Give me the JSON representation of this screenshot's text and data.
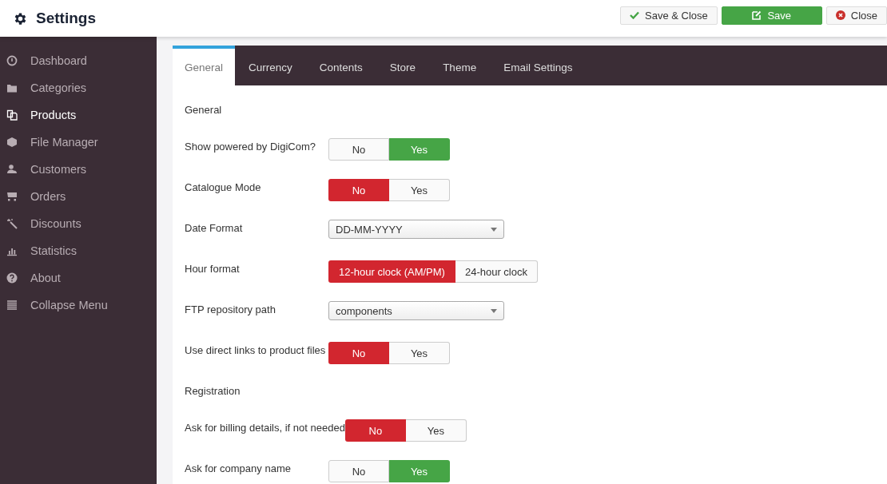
{
  "header": {
    "title": "Settings",
    "buttons": [
      {
        "label": "Save & Close",
        "kind": "save-close"
      },
      {
        "label": "Save",
        "kind": "save"
      },
      {
        "label": "Close",
        "kind": "close"
      }
    ]
  },
  "sidebar": {
    "items": [
      {
        "label": "Dashboard",
        "selected": false
      },
      {
        "label": "Categories",
        "selected": false
      },
      {
        "label": "Products",
        "selected": true
      },
      {
        "label": "File Manager",
        "selected": false
      },
      {
        "label": "Customers",
        "selected": false
      },
      {
        "label": "Orders",
        "selected": false
      },
      {
        "label": "Discounts",
        "selected": false
      },
      {
        "label": "Statistics",
        "selected": false
      },
      {
        "label": "About",
        "selected": false
      },
      {
        "label": "Collapse Menu",
        "selected": false
      }
    ]
  },
  "tabs": [
    {
      "label": "General",
      "selected": true
    },
    {
      "label": "Currency",
      "selected": false
    },
    {
      "label": "Contents",
      "selected": false
    },
    {
      "label": "Store",
      "selected": false
    },
    {
      "label": "Theme",
      "selected": false
    },
    {
      "label": "Email Settings",
      "selected": false
    }
  ],
  "fields": [
    {
      "kind": "section",
      "label": "General"
    },
    {
      "kind": "toggle",
      "label": "Show powered by DigiCom?",
      "options": [
        {
          "label": "No",
          "selected": false
        },
        {
          "label": "Yes",
          "selected": true,
          "color": "#46a546"
        }
      ]
    },
    {
      "kind": "toggle",
      "label": "Catalogue Mode",
      "options": [
        {
          "label": "No",
          "selected": true,
          "color": "#d2262f"
        },
        {
          "label": "Yes",
          "selected": false
        }
      ]
    },
    {
      "kind": "select",
      "label": "Date Format",
      "value": "DD-MM-YYYY"
    },
    {
      "kind": "toggle",
      "label": "Hour format",
      "options": [
        {
          "label": "12-hour clock (AM/PM)",
          "selected": true,
          "color": "#d2262f"
        },
        {
          "label": "24-hour clock",
          "selected": false
        }
      ]
    },
    {
      "kind": "select",
      "label": "FTP repository path",
      "value": "components"
    },
    {
      "kind": "toggle",
      "label": "Use direct links to product files",
      "options": [
        {
          "label": "No",
          "selected": true,
          "color": "#d2262f"
        },
        {
          "label": "Yes",
          "selected": false
        }
      ]
    },
    {
      "kind": "section",
      "label": "Registration"
    },
    {
      "kind": "toggle",
      "label": "Ask for billing details, if not needed",
      "options": [
        {
          "label": "No",
          "selected": true,
          "color": "#d2262f"
        },
        {
          "label": "Yes",
          "selected": false
        }
      ]
    },
    {
      "kind": "toggle",
      "label": "Ask for company name",
      "options": [
        {
          "label": "No",
          "selected": false
        },
        {
          "label": "Yes",
          "selected": true,
          "color": "#46a546"
        }
      ]
    }
  ]
}
